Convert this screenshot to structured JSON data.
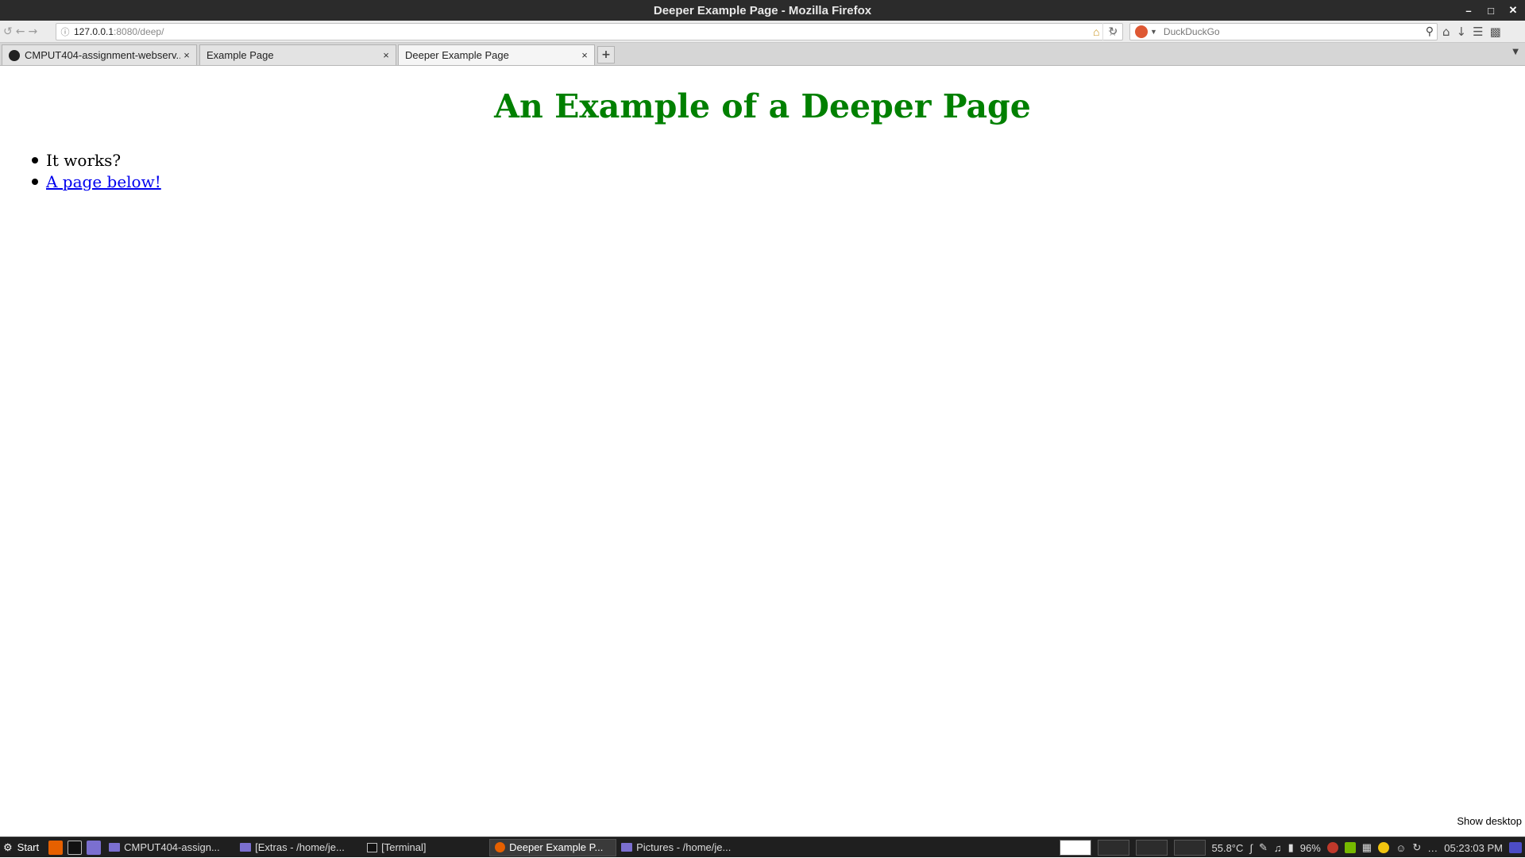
{
  "window": {
    "title": "Deeper Example Page - Mozilla Firefox",
    "controls": {
      "minimize": "–",
      "maximize": "□",
      "close": "✕"
    }
  },
  "navbar": {
    "url_host": "127.0.0.1",
    "url_rest": ":8080/deep/",
    "search_engine": "DuckDuckGo",
    "icons": [
      "history-back-icon",
      "back-icon",
      "forward-icon",
      "info-icon",
      "home-icon",
      "bookmark-star-icon",
      "reload-icon",
      "search-icon",
      "home-icon",
      "download-icon",
      "menu-icon",
      "extension-icon"
    ]
  },
  "tabs": [
    {
      "label": "CMPUT404-assignment-webserv...",
      "close": "×"
    },
    {
      "label": "Example Page",
      "close": "×"
    },
    {
      "label": "Deeper Example Page",
      "close": "×"
    }
  ],
  "newtab": {
    "label": "+"
  },
  "page": {
    "heading": "An Example of a Deeper Page",
    "items": [
      {
        "text": "It works?"
      },
      {
        "text": "A page below!",
        "link": true
      }
    ]
  },
  "desktop": {
    "show_desktop": "Show desktop"
  },
  "taskbar": {
    "start_label": "Start",
    "tasks": [
      {
        "label": "CMPUT404-assign...",
        "icon": "folder-icon"
      },
      {
        "label": "[Extras - /home/je...",
        "icon": "folder-icon"
      },
      {
        "label": "[Terminal]",
        "icon": "terminal-icon"
      },
      {
        "label": "Deeper Example P...",
        "icon": "firefox-icon",
        "active": true
      },
      {
        "label": "Pictures - /home/je...",
        "icon": "folder-icon"
      }
    ],
    "temperature": "55.8°C",
    "battery": "96%",
    "clock": "05:23:03 PM"
  }
}
